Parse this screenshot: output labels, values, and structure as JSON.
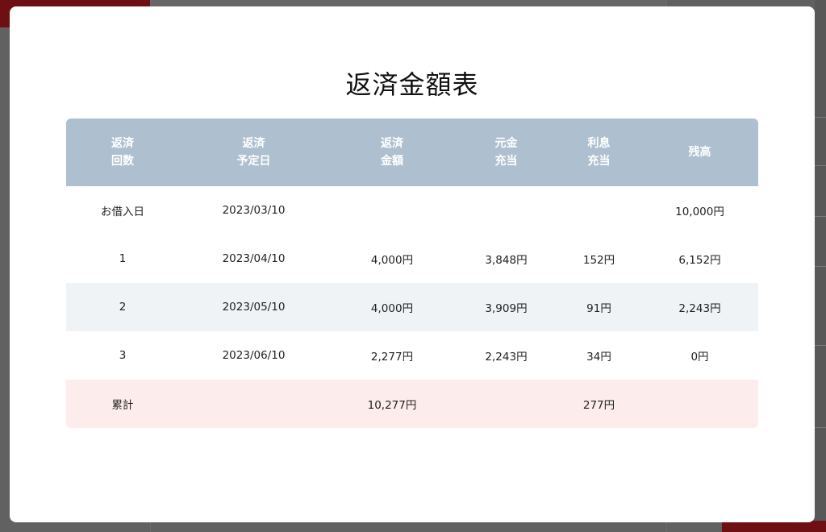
{
  "modal": {
    "title": "返済金額表"
  },
  "table": {
    "headers": [
      {
        "line1": "返済",
        "line2": "回数"
      },
      {
        "line1": "返済",
        "line2": "予定日"
      },
      {
        "line1": "返済",
        "line2": "金額"
      },
      {
        "line1": "元金",
        "line2": "充当"
      },
      {
        "line1": "利息",
        "line2": "充当"
      },
      {
        "line1": "残高",
        "line2": ""
      }
    ],
    "rows": [
      {
        "no": "お借入日",
        "date": "2023/03/10",
        "amount": "",
        "principal": "",
        "interest": "",
        "balance": "10,000円"
      },
      {
        "no": "1",
        "date": "2023/04/10",
        "amount": "4,000円",
        "principal": "3,848円",
        "interest": "152円",
        "balance": "6,152円"
      },
      {
        "no": "2",
        "date": "2023/05/10",
        "amount": "4,000円",
        "principal": "3,909円",
        "interest": "91円",
        "balance": "2,243円"
      },
      {
        "no": "3",
        "date": "2023/06/10",
        "amount": "2,277円",
        "principal": "2,243円",
        "interest": "34円",
        "balance": "0円"
      }
    ],
    "total": {
      "label": "累計",
      "amount": "10,277円",
      "interest": "277円"
    }
  }
}
